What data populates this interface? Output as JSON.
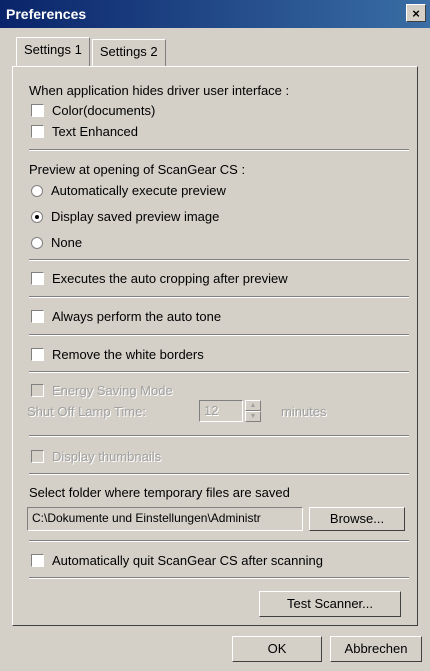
{
  "window": {
    "title": "Preferences",
    "close_symbol": "×"
  },
  "tabs": [
    "Settings 1",
    "Settings 2"
  ],
  "ui_hide_section": {
    "label": "When application hides driver user interface :",
    "options": [
      {
        "label": "Color(documents)",
        "checked": false
      },
      {
        "label": "Text Enhanced",
        "checked": false
      }
    ]
  },
  "preview_section": {
    "label": "Preview at opening of ScanGear CS :",
    "options": [
      {
        "label": "Automatically execute preview",
        "selected": false
      },
      {
        "label": "Display saved preview image",
        "selected": true
      },
      {
        "label": "None",
        "selected": false
      }
    ]
  },
  "auto_cropping": {
    "label": "Executes the auto cropping after preview",
    "checked": false
  },
  "auto_tone": {
    "label": "Always perform the auto tone",
    "checked": false
  },
  "white_borders": {
    "label": "Remove the white borders",
    "checked": false
  },
  "energy_saving": {
    "label": "Energy Saving Mode",
    "checked": false,
    "lamp_label": "Shut Off Lamp Time:",
    "lamp_value": "12",
    "units": "minutes"
  },
  "thumbnails": {
    "label": "Display thumbnails",
    "checked": false
  },
  "temp_folder": {
    "label": "Select folder where temporary files are saved",
    "path": "C:\\Dokumente und Einstellungen\\Administr",
    "browse_label": "Browse..."
  },
  "auto_quit": {
    "label": "Automatically quit ScanGear CS after scanning",
    "checked": false
  },
  "test_scanner_label": "Test Scanner...",
  "footer": {
    "ok_label": "OK",
    "cancel_label": "Abbrechen"
  }
}
